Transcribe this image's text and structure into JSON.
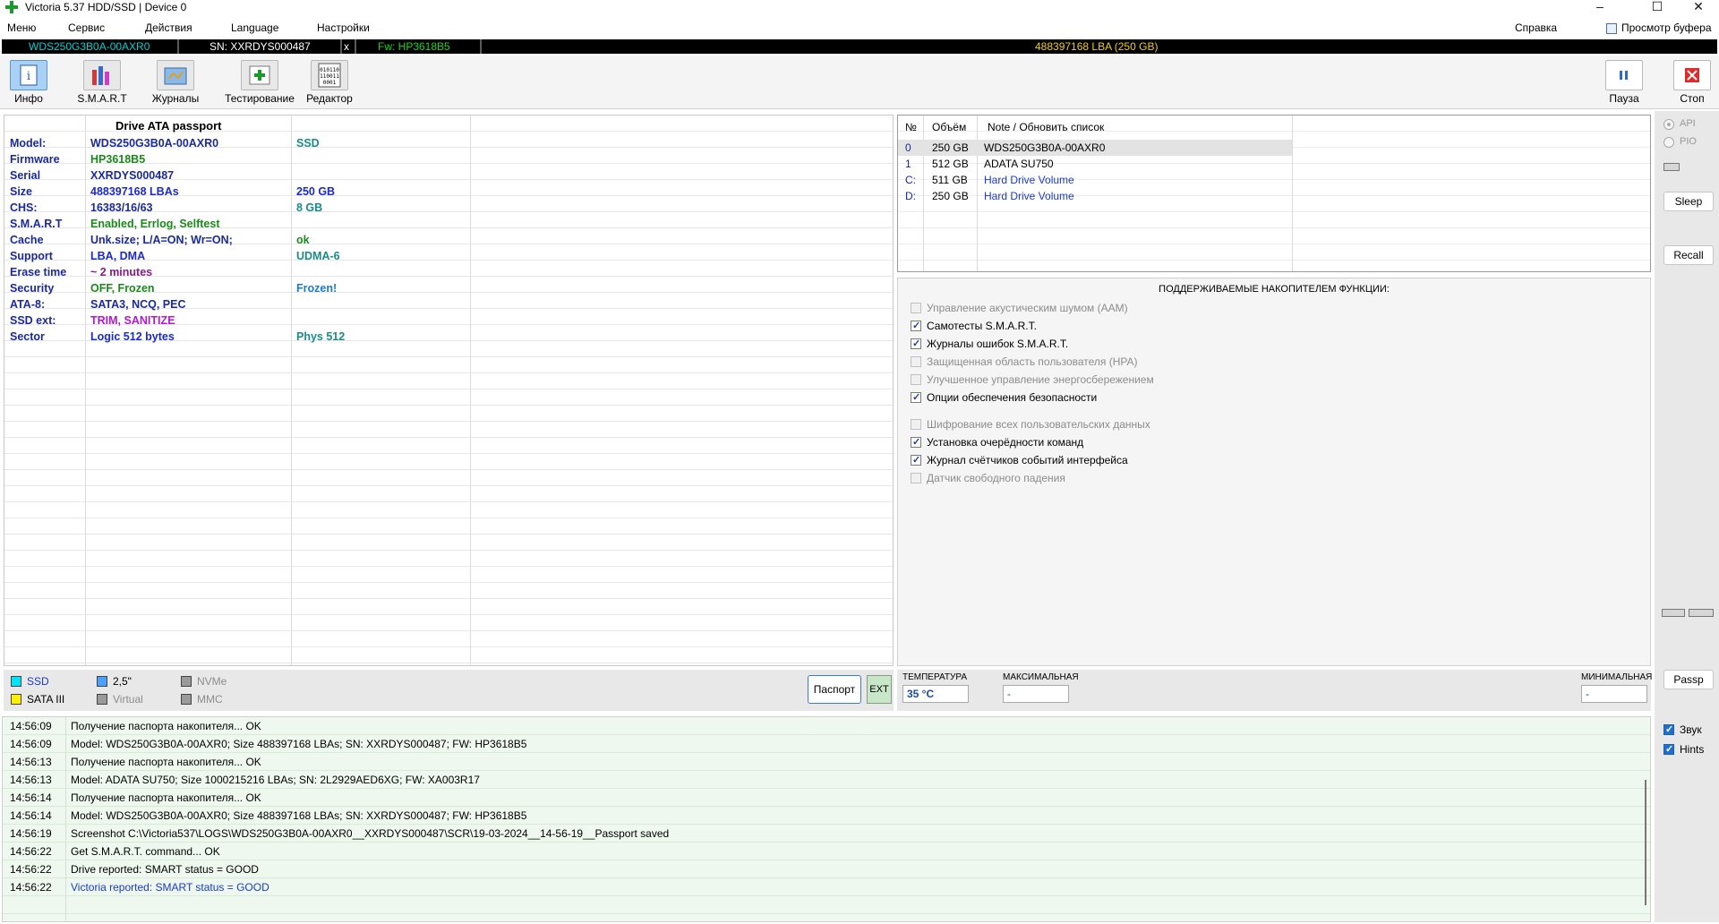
{
  "window": {
    "title": "Victoria 5.37 HDD/SSD | Device 0",
    "minimize": "–",
    "maximize": "☐",
    "close": "✕"
  },
  "menu": {
    "items": [
      "Меню",
      "Сервис",
      "Действия",
      "Language",
      "Настройки"
    ],
    "help": "Справка",
    "buffer_view": "Просмотр буфера"
  },
  "drive_bar": {
    "model": "WDS250G3B0A-00AXR0",
    "serial": "SN: XXRDYS000487",
    "x": "x",
    "firmware": "Fw: HP3618B5",
    "capacity": "488397168 LBA (250 GB)",
    "colors": {
      "model": "#00d0d0",
      "serial": "#ffffff",
      "firmware": "#19d619",
      "capacity": "#f0d000"
    }
  },
  "toolbar": {
    "info": "Инфо",
    "smart": "S.M.A.R.T",
    "logs": "Журналы",
    "testing": "Тестирование",
    "editor": "Редактор",
    "pause": "Пауза",
    "stop": "Стоп",
    "icons": [
      "info-icon",
      "smart-icon",
      "logs-icon",
      "testing-icon",
      "editor-icon",
      "pause-icon",
      "stop-icon"
    ]
  },
  "passport": {
    "heading": "Drive ATA passport",
    "rows": [
      {
        "key": "Model:",
        "value": "WDS250G3B0A-00AXR0",
        "value_color": "#1a2a9a",
        "extra": "SSD",
        "extra_color": "#1a8a8a"
      },
      {
        "key": "Firmware",
        "value": "HP3618B5",
        "value_color": "#1a8a1a",
        "extra": "",
        "extra_color": "#000"
      },
      {
        "key": "Serial",
        "value": "XXRDYS000487",
        "value_color": "#1a2a9a",
        "extra": "",
        "extra_color": "#000"
      },
      {
        "key": "Size",
        "value": "488397168 LBAs",
        "value_color": "#1a2acc",
        "extra": "250 GB",
        "extra_color": "#1a2acc"
      },
      {
        "key": "CHS:",
        "value": "16383/16/63",
        "value_color": "#1a2a9a",
        "extra": "8 GB",
        "extra_color": "#1a8a8a"
      },
      {
        "key": "S.M.A.R.T",
        "value": "Enabled, Errlog, Selftest",
        "value_color": "#1a8a1a",
        "extra": "",
        "extra_color": "#000"
      },
      {
        "key": "Cache",
        "value": "Unk.size; L/A=ON; Wr=ON;",
        "value_color": "#1a2a9a",
        "extra": "ok",
        "extra_color": "#1a8a1a"
      },
      {
        "key": "Support",
        "value": "LBA, DMA",
        "value_color": "#1a2acc",
        "extra": "UDMA-6",
        "extra_color": "#1a8a8a"
      },
      {
        "key": "Erase time",
        "value": "~ 2 minutes",
        "value_color": "#8a1a8a",
        "extra": "",
        "extra_color": "#000"
      },
      {
        "key": "Security",
        "value": "OFF, Frozen",
        "value_color": "#1a8a1a",
        "extra": "Frozen!",
        "extra_color": "#1a7acc"
      },
      {
        "key": "ATA-8:",
        "value": "SATA3, NCQ, PEC",
        "value_color": "#1a2a9a",
        "extra": "",
        "extra_color": "#000"
      },
      {
        "key": "SSD ext:",
        "value": "TRIM, SANITIZE",
        "value_color": "#b01ad0",
        "extra": "",
        "extra_color": "#000"
      },
      {
        "key": "Sector",
        "value": "Logic 512 bytes",
        "value_color": "#1a2acc",
        "extra": "Phys 512",
        "extra_color": "#1a8a8a"
      }
    ]
  },
  "devices": {
    "headers": {
      "num": "№",
      "size": "Объём",
      "note": "Note / Обновить список"
    },
    "rows": [
      {
        "num": "0",
        "size": "250 GB",
        "model": "WDS250G3B0A-00AXR0",
        "color": "#000",
        "selected": true
      },
      {
        "num": "1",
        "size": "512 GB",
        "model": "ADATA SU750",
        "color": "#000",
        "selected": false
      },
      {
        "num": "C:",
        "size": "511 GB",
        "model": "Hard Drive Volume",
        "color": "#1a3acc",
        "selected": false
      },
      {
        "num": "D:",
        "size": "250 GB",
        "model": "Hard Drive Volume",
        "color": "#1a3acc",
        "selected": false
      }
    ]
  },
  "features": {
    "title": "ПОДДЕРЖИВАЕМЫЕ НАКОПИТЕЛЕМ ФУНКЦИИ:",
    "items": [
      {
        "label": "Управление акустическим шумом (AAM)",
        "checked": false,
        "disabled": true
      },
      {
        "label": "Самотесты S.M.A.R.T.",
        "checked": true,
        "disabled": false
      },
      {
        "label": "Журналы ошибок S.M.A.R.T.",
        "checked": true,
        "disabled": false
      },
      {
        "label": "Защищенная область пользователя (HPA)",
        "checked": false,
        "disabled": true
      },
      {
        "label": "Улучшенное управление энергосбережением",
        "checked": false,
        "disabled": true
      },
      {
        "label": "Опции обеспечения безопасности",
        "checked": true,
        "disabled": false
      },
      {
        "label": "Шифрование всех пользовательских данных",
        "checked": false,
        "disabled": true
      },
      {
        "label": "Установка очерёдности команд",
        "checked": true,
        "disabled": false
      },
      {
        "label": "Журнал счётчиков событий интерфейса",
        "checked": true,
        "disabled": false
      },
      {
        "label": "Датчик свободного падения",
        "checked": false,
        "disabled": true
      }
    ]
  },
  "side": {
    "api": "API",
    "pio": "PIO",
    "sleep": "Sleep",
    "recall": "Recall",
    "passp": "Passp",
    "sound": "Звук",
    "hints": "Hints"
  },
  "legend": {
    "ssd": "SSD",
    "sata": "SATA III",
    "size25": "2,5\"",
    "virtual": "Virtual",
    "nvme": "NVMe",
    "mmc": "MMC",
    "passport_btn": "Паспорт",
    "ext_btn": "EXT",
    "colors": {
      "ssd": "#00e5ff",
      "sata": "#ffee00",
      "size25": "#4aa0ff",
      "virtual": "#9a9a9a",
      "nvme": "#9a9a9a",
      "mmc": "#9a9a9a"
    }
  },
  "temperature": {
    "label": "ТЕМПЕРАТУРА",
    "value": "35 °C",
    "max_label": "МАКСИМАЛЬНАЯ",
    "max_value": "-",
    "min_label": "МИНИМАЛЬНАЯ",
    "min_value": "-"
  },
  "log": [
    {
      "time": "14:56:09",
      "msg": "Получение паспорта накопителя... OK",
      "color": "#000"
    },
    {
      "time": "14:56:09",
      "msg": "Model: WDS250G3B0A-00AXR0; Size 488397168 LBAs; SN: XXRDYS000487; FW: HP3618B5",
      "color": "#000"
    },
    {
      "time": "14:56:13",
      "msg": "Получение паспорта накопителя... OK",
      "color": "#000"
    },
    {
      "time": "14:56:13",
      "msg": "Model: ADATA SU750; Size 1000215216 LBAs; SN: 2L2929AED6XG; FW: XA003R17",
      "color": "#000"
    },
    {
      "time": "14:56:14",
      "msg": "Получение паспорта накопителя... OK",
      "color": "#000"
    },
    {
      "time": "14:56:14",
      "msg": "Model: WDS250G3B0A-00AXR0; Size 488397168 LBAs; SN: XXRDYS000487; FW: HP3618B5",
      "color": "#000"
    },
    {
      "time": "14:56:19",
      "msg": "Screenshot C:\\Victoria537\\LOGS\\WDS250G3B0A-00AXR0__XXRDYS000487\\SCR\\19-03-2024__14-56-19__Passport saved",
      "color": "#000"
    },
    {
      "time": "14:56:22",
      "msg": "Get S.M.A.R.T. command... OK",
      "color": "#000"
    },
    {
      "time": "14:56:22",
      "msg": "Drive reported: SMART status = GOOD",
      "color": "#000"
    },
    {
      "time": "14:56:22",
      "msg": "Victoria reported: SMART status = GOOD",
      "color": "#1a3acc"
    }
  ]
}
